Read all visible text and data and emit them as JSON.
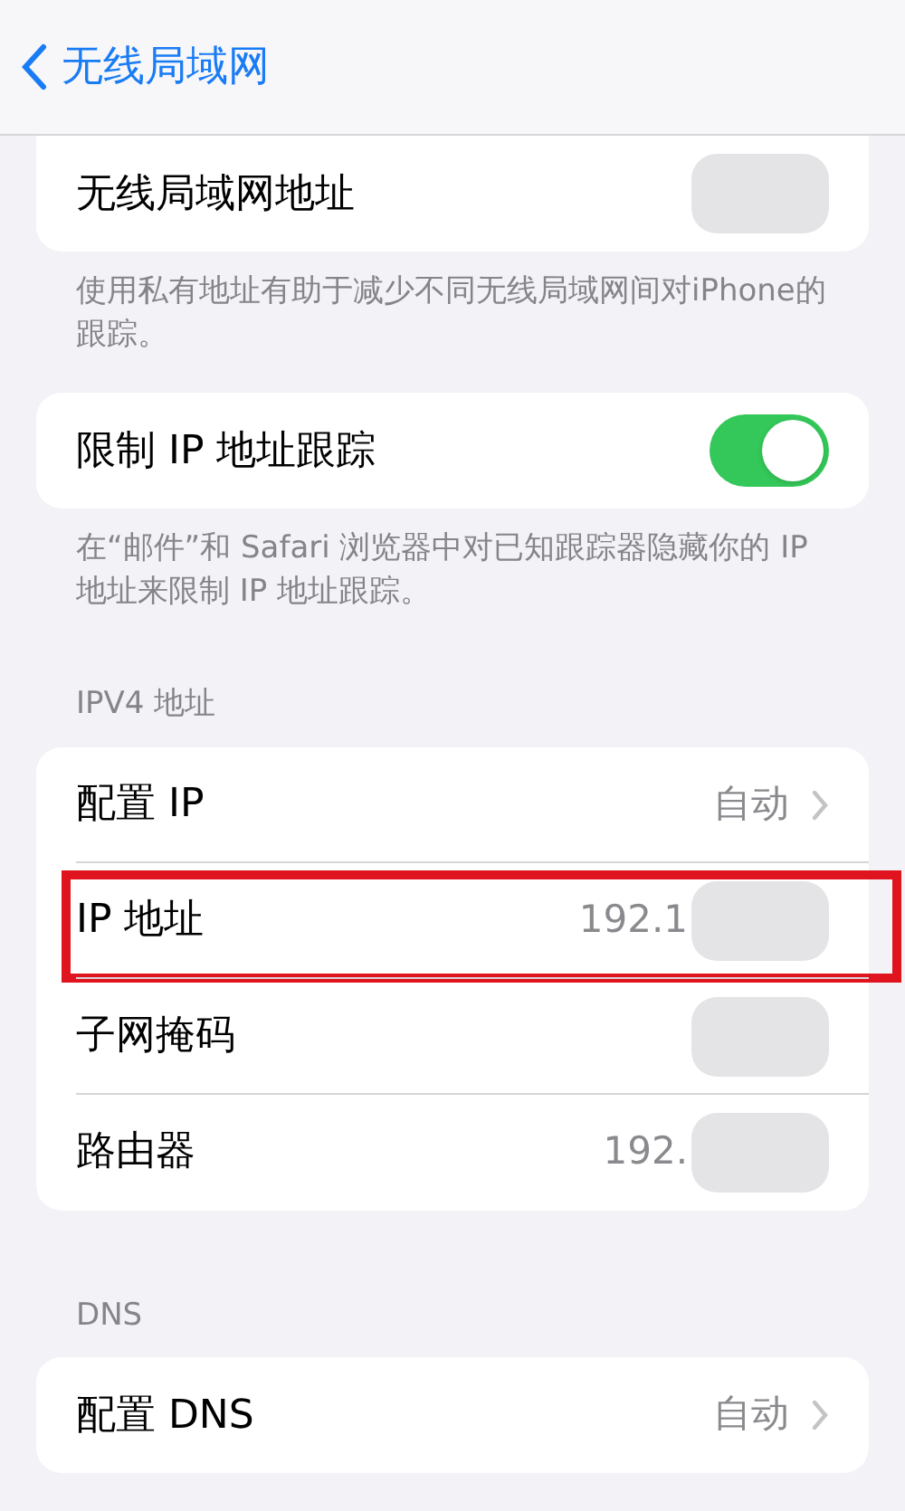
{
  "nav": {
    "back_label": "无线局域网"
  },
  "sections": [
    {
      "rows": [
        {
          "kind": "value",
          "label": "无线局域网地址",
          "value": "",
          "redacted": true,
          "chevron": false
        }
      ],
      "footer": "使用私有地址有助于减少不同无线局域网间对iPhone的跟踪。"
    },
    {
      "rows": [
        {
          "kind": "toggle",
          "label": "限制 IP 地址跟踪",
          "on": true
        }
      ],
      "footer": "在“邮件”和 Safari 浏览器中对已知跟踪器隐藏你的 IP 地址来限制 IP 地址跟踪。"
    },
    {
      "header": "IPV4 地址",
      "rows": [
        {
          "kind": "value",
          "label": "配置 IP",
          "value": "自动",
          "redacted": false,
          "chevron": true
        },
        {
          "kind": "value",
          "label": "IP 地址",
          "value": "192.1",
          "redacted": true,
          "chevron": false,
          "highlighted": true
        },
        {
          "kind": "value",
          "label": "子网掩码",
          "value": "",
          "redacted": true,
          "chevron": false
        },
        {
          "kind": "value",
          "label": "路由器",
          "value": "192.",
          "redacted": true,
          "chevron": false
        }
      ]
    },
    {
      "header": "DNS",
      "rows": [
        {
          "kind": "value",
          "label": "配置 DNS",
          "value": "自动",
          "redacted": false,
          "chevron": true
        }
      ]
    }
  ]
}
